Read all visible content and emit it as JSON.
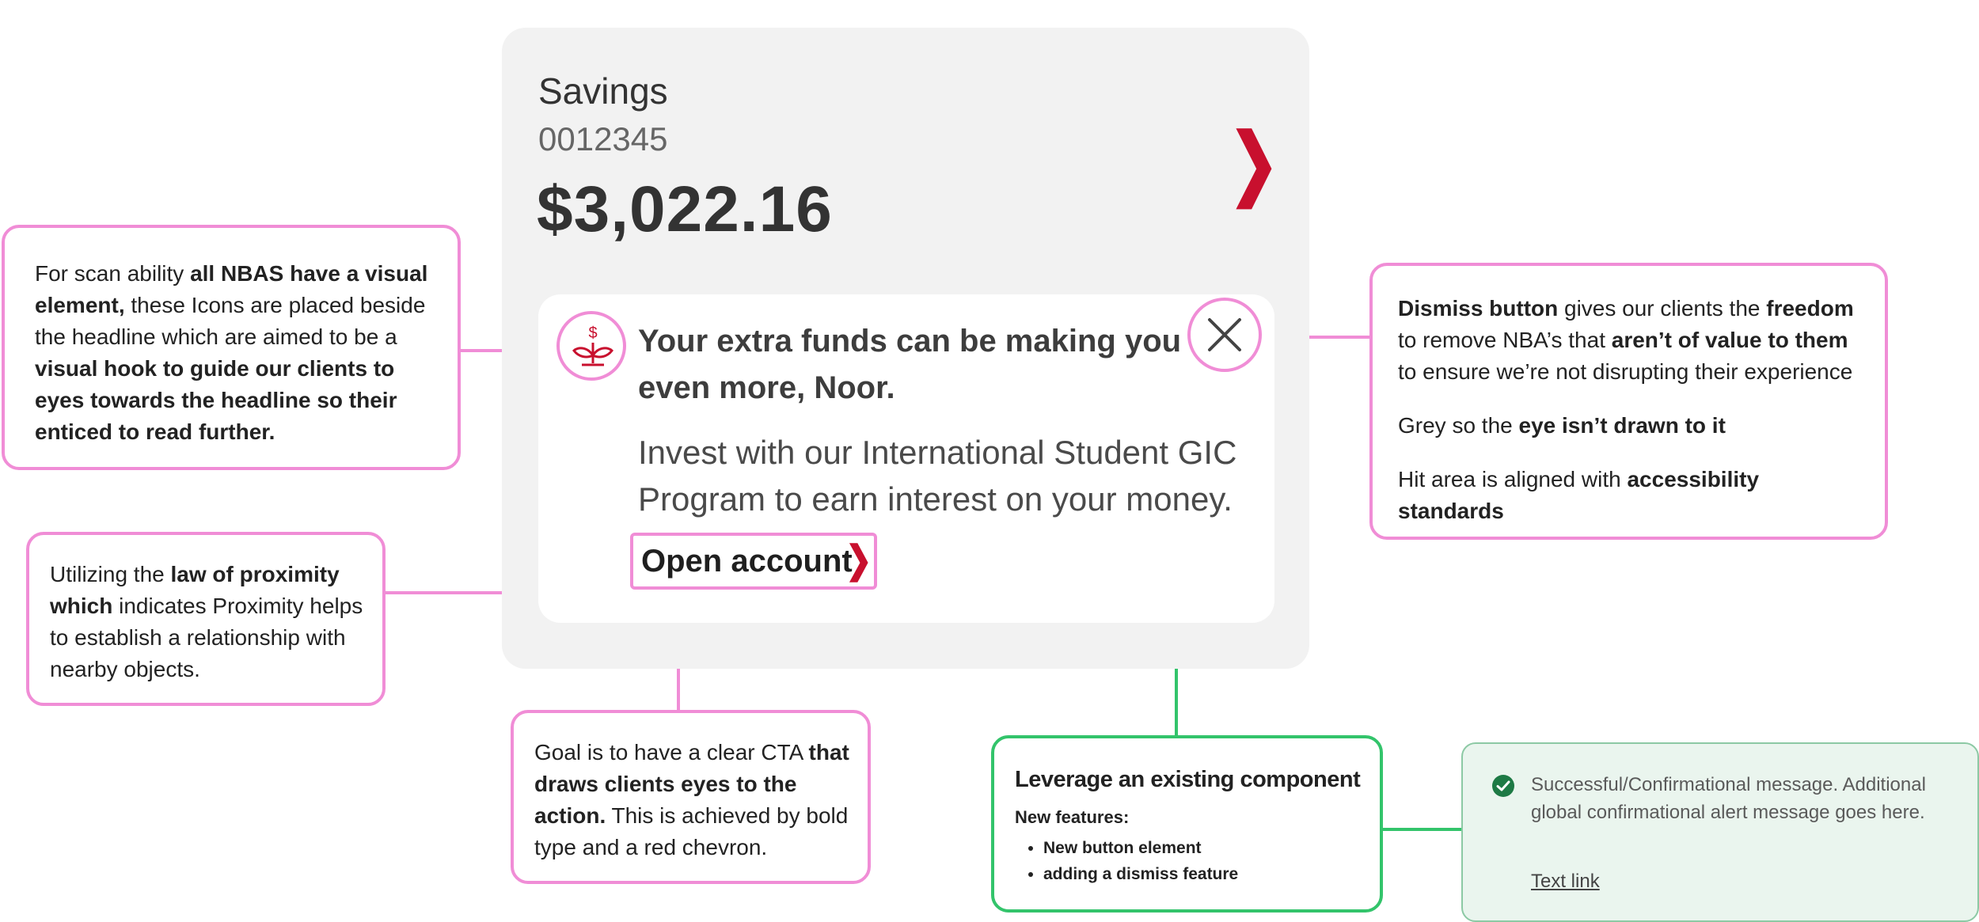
{
  "account": {
    "name": "Savings",
    "number": "0012345",
    "balance": "$3,022.16",
    "chevron": "❯"
  },
  "nba": {
    "icon": "plant-dollar-icon",
    "headline": "Your extra funds can be making you even more, Noor.",
    "body": "Invest with our International Student GIC Program to earn interest on your money.",
    "cta_label": "Open account",
    "cta_chevron": "❯",
    "dismiss_icon": "close-icon"
  },
  "annotations": {
    "icon_note": {
      "t1": "For scan ability ",
      "b1": "all NBAS have a visual element,",
      "t2": " these Icons are placed beside the headline which are aimed to be a ",
      "b2": "visual hook to guide our clients to eyes towards the headline so their enticed to read further."
    },
    "proximity_note": {
      "t1": "Utilizing the ",
      "b1": "law of proximity which",
      "t2": " indicates Proximity helps to establish a relationship with nearby objects."
    },
    "cta_note": {
      "t1": "Goal is to have a clear CTA ",
      "b1": "that draws clients eyes to the action.",
      "t2": " This is achieved by bold type and a red chevron."
    },
    "dismiss_note": {
      "p1_b1": "Dismiss button",
      "p1_t1": " gives our clients the ",
      "p1_b2": "freedom",
      "p1_t2": " to remove NBA’s that ",
      "p1_b3": "aren’t of value to them",
      "p1_t3": " to ensure we’re not disrupting their experience",
      "p2_t1": "Grey so the ",
      "p2_b1": "eye isn’t drawn to it",
      "p3_t1": "Hit area is aligned with ",
      "p3_b1": "accessibility standards"
    },
    "component_note": {
      "title": "Leverage an existing component",
      "subtitle": "New features:",
      "items": [
        "New button element",
        "adding a dismiss feature"
      ]
    }
  },
  "alert": {
    "icon": "check-circle-icon",
    "message": "Successful/Confirmational message. Additional global confirmational alert message goes here.",
    "link": "Text link"
  },
  "colors": {
    "annotation_pink": "#f08dd6",
    "annotation_green": "#33c46b",
    "brand_red": "#c8102e",
    "card_bg": "#f2f2f2",
    "alert_bg": "#eaf5ee",
    "alert_check": "#1e7a45"
  }
}
